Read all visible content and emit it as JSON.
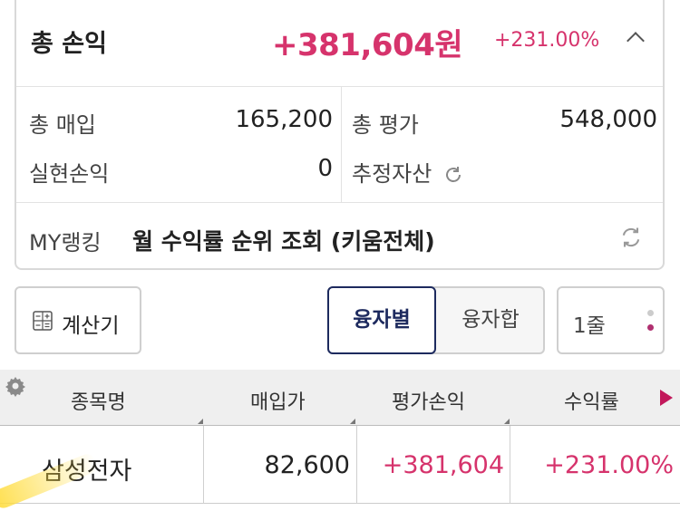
{
  "summary": {
    "total_pl_label": "총 손익",
    "total_pl_amount": "+381,604원",
    "total_pl_rate": "+231.00%",
    "purchase_label": "총 매입",
    "purchase_value": "165,200",
    "evaluation_label": "총 평가",
    "evaluation_value": "548,000",
    "realized_label": "실현손익",
    "realized_value": "0",
    "estimated_label": "추정자산"
  },
  "ranking": {
    "label": "MY랭킹",
    "text": "월 수익률 순위 조회 (키움전체)"
  },
  "toolbar": {
    "calculator_label": "계산기",
    "tab_by_loan": "융자별",
    "tab_loan_sum": "융자합",
    "rows_label": "1줄"
  },
  "table": {
    "headers": [
      "종목명",
      "매입가",
      "평가손익",
      "수익률"
    ],
    "rows": [
      {
        "name": "삼성전자",
        "price": "82,600",
        "pl": "+381,604",
        "rate": "+231.00%"
      }
    ]
  },
  "colors": {
    "positive": "#d6336c",
    "selected_tab": "#1d2a5e"
  }
}
